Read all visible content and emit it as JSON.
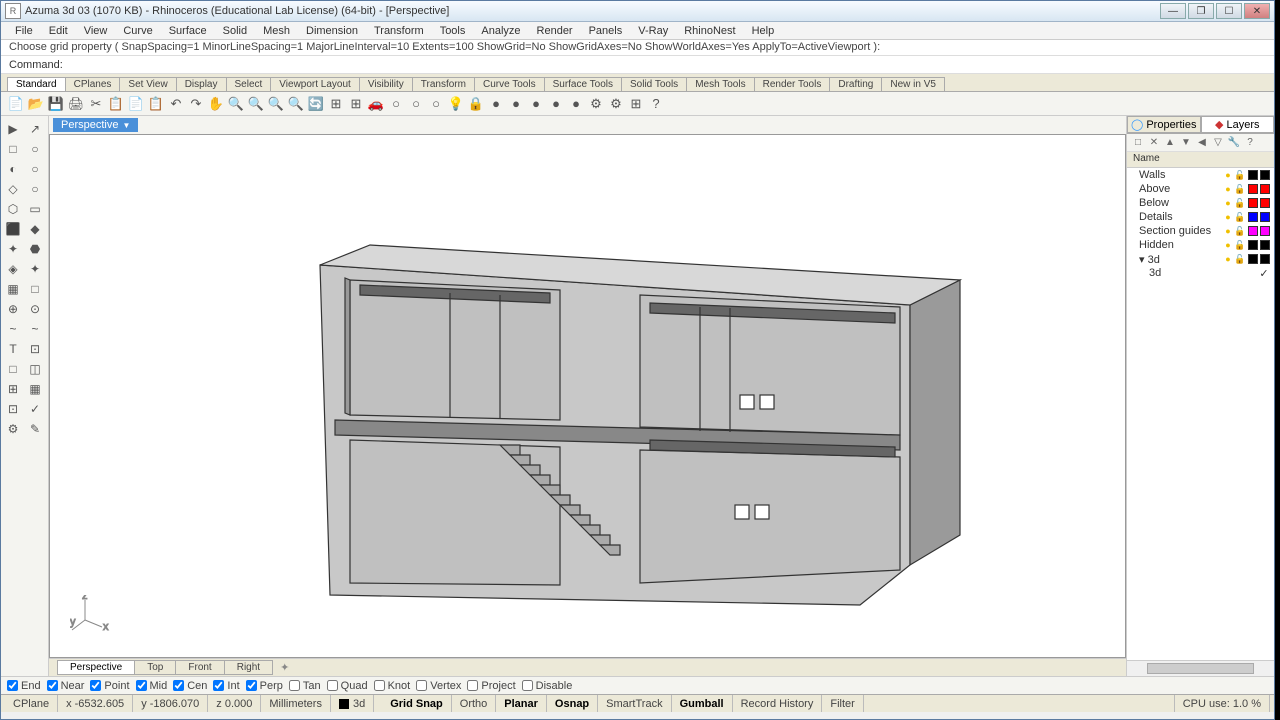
{
  "title": "Azuma 3d 03 (1070 KB) - Rhinoceros (Educational Lab License) (64-bit) - [Perspective]",
  "menus": [
    "File",
    "Edit",
    "View",
    "Curve",
    "Surface",
    "Solid",
    "Mesh",
    "Dimension",
    "Transform",
    "Tools",
    "Analyze",
    "Render",
    "Panels",
    "V-Ray",
    "RhinoNest",
    "Help"
  ],
  "history": "Choose grid property ( SnapSpacing=1  MinorLineSpacing=1  MajorLineInterval=10  Extents=100  ShowGrid=No  ShowGridAxes=No  ShowWorldAxes=Yes  ApplyTo=ActiveViewport ):",
  "command_label": "Command:",
  "tabs": [
    "Standard",
    "CPlanes",
    "Set View",
    "Display",
    "Select",
    "Viewport Layout",
    "Visibility",
    "Transform",
    "Curve Tools",
    "Surface Tools",
    "Solid Tools",
    "Mesh Tools",
    "Render Tools",
    "Drafting",
    "New in V5"
  ],
  "active_tab": 0,
  "viewport_tab": "Perspective",
  "bottom_tabs": [
    "Perspective",
    "Top",
    "Front",
    "Right"
  ],
  "active_bottom_tab": 0,
  "right_tabs": {
    "properties": "Properties",
    "layers": "Layers"
  },
  "layer_header": "Name",
  "layers": [
    {
      "name": "Walls",
      "color": "#000000"
    },
    {
      "name": "Above",
      "color": "#ff0000"
    },
    {
      "name": "Below",
      "color": "#ff0000"
    },
    {
      "name": "Details",
      "color": "#0000ff"
    },
    {
      "name": "Section guides",
      "color": "#ff00ff"
    },
    {
      "name": "Hidden",
      "color": "#000000"
    },
    {
      "name": "3d",
      "color": "#000000",
      "expanded": true,
      "bulb": "#f0c000"
    },
    {
      "name": "3d",
      "indent": true,
      "checked": true
    }
  ],
  "osnaps": [
    {
      "label": "End",
      "on": true
    },
    {
      "label": "Near",
      "on": true
    },
    {
      "label": "Point",
      "on": true
    },
    {
      "label": "Mid",
      "on": true
    },
    {
      "label": "Cen",
      "on": true
    },
    {
      "label": "Int",
      "on": true
    },
    {
      "label": "Perp",
      "on": true
    },
    {
      "label": "Tan",
      "on": false
    },
    {
      "label": "Quad",
      "on": false
    },
    {
      "label": "Knot",
      "on": false
    },
    {
      "label": "Vertex",
      "on": false
    },
    {
      "label": "Project",
      "on": false
    },
    {
      "label": "Disable",
      "on": false
    }
  ],
  "status": {
    "cplane": "CPlane",
    "x": "x -6532.605",
    "y": "y -1806.070",
    "z": "z 0.000",
    "units": "Millimeters",
    "layer": "3d",
    "toggles": [
      {
        "label": "Grid Snap",
        "on": true
      },
      {
        "label": "Ortho",
        "on": false
      },
      {
        "label": "Planar",
        "on": true
      },
      {
        "label": "Osnap",
        "on": true
      },
      {
        "label": "SmartTrack",
        "on": false
      },
      {
        "label": "Gumball",
        "on": true
      },
      {
        "label": "Record History",
        "on": false
      },
      {
        "label": "Filter",
        "on": false
      }
    ],
    "cpu": "CPU use: 1.0 %"
  },
  "toolbar_icons": [
    "📄",
    "📂",
    "💾",
    "🖨",
    "✂",
    "📋",
    "📄",
    "📋",
    "↶",
    "↷",
    "✋",
    "🔍",
    "🔍",
    "🔍",
    "🔍",
    "🔄",
    "⊞",
    "⊞",
    "🚗",
    "○",
    "○",
    "○",
    "💡",
    "🔒",
    "●",
    "●",
    "●",
    "●",
    "●",
    "⚙",
    "⚙",
    "⊞",
    "?"
  ],
  "left_tools": [
    "▶",
    "↗",
    "□",
    "○",
    "◐",
    "○",
    "◇",
    "○",
    "⬡",
    "▭",
    "⬛",
    "◆",
    "✦",
    "⬣",
    "◈",
    "✦",
    "▦",
    "□",
    "⊕",
    "⊙",
    "~",
    "~",
    "T",
    "⊡",
    "□",
    "◫",
    "⊞",
    "▦",
    "⊡",
    "✓",
    "⚙",
    "✎"
  ]
}
